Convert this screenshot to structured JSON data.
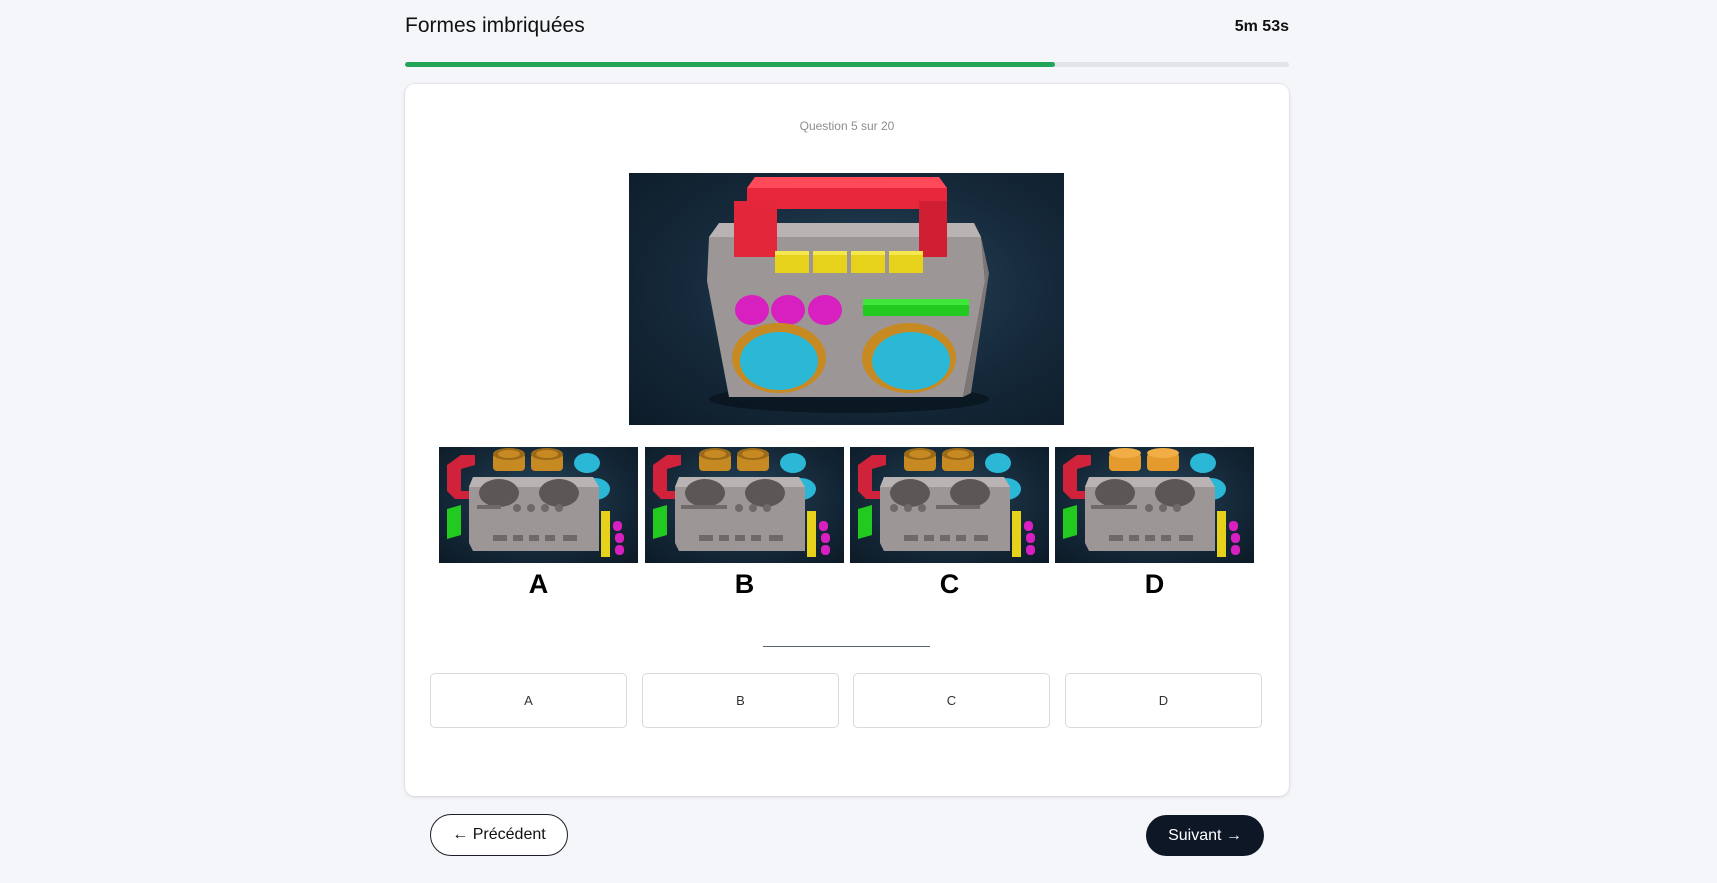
{
  "header": {
    "title": "Formes imbriquées",
    "timer": "5m 53s",
    "progress_fraction": 0.735
  },
  "question": {
    "counter": "Question 5 sur 20"
  },
  "figure_options": [
    {
      "letter": "A"
    },
    {
      "letter": "B"
    },
    {
      "letter": "C"
    },
    {
      "letter": "D"
    }
  ],
  "answers": [
    {
      "label": "A"
    },
    {
      "label": "B"
    },
    {
      "label": "C"
    },
    {
      "label": "D"
    }
  ],
  "nav": {
    "prev_label": "← Précédent",
    "next_label": "Suivant →"
  },
  "colors": {
    "progress": "#22a559",
    "next_button_bg": "#0e1726"
  }
}
